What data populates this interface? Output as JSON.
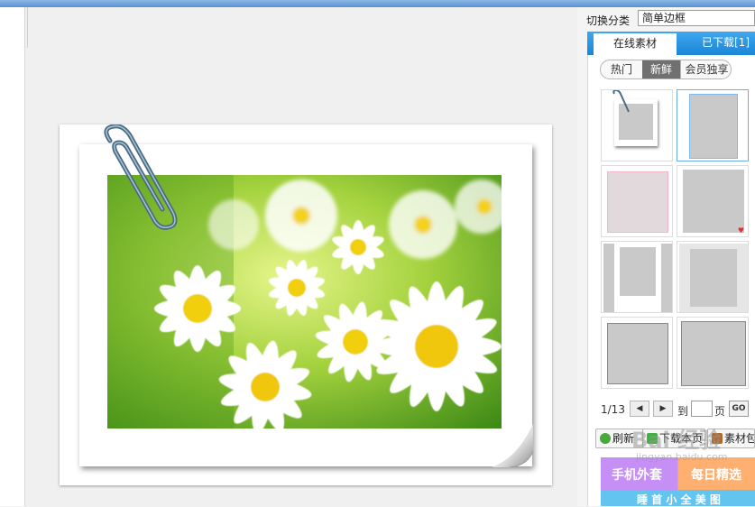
{
  "switch_category": {
    "label": "切换分类",
    "selected": "简单边框"
  },
  "tabs": {
    "online": "在线素材",
    "downloaded": "已下载[1]"
  },
  "filters": [
    "热门",
    "新鲜",
    "会员独享"
  ],
  "active_filter": "新鲜",
  "pager": {
    "page_indicator": "1/13",
    "prev": "◀",
    "next": "▶",
    "to_label": "到",
    "page_unit": "页",
    "page_input_value": "",
    "go_label": "GO"
  },
  "actions": {
    "refresh": "刷新",
    "download_page": "下载本页",
    "material": "素材包"
  },
  "banners": {
    "handwriting": "手机外套",
    "daily_picks": "每日精选",
    "bottom": "睡 首 小 全 美 图"
  },
  "watermark": {
    "brand": "Bai 经验",
    "url": "jingyan.baidu.com"
  },
  "colors": {
    "tab_blue": "#1b86d6",
    "banner_purple": "#c58ff5",
    "banner_orange": "#ffb070",
    "banner_cyan": "#62c4ef",
    "selection_blue": "#6aaee8"
  }
}
